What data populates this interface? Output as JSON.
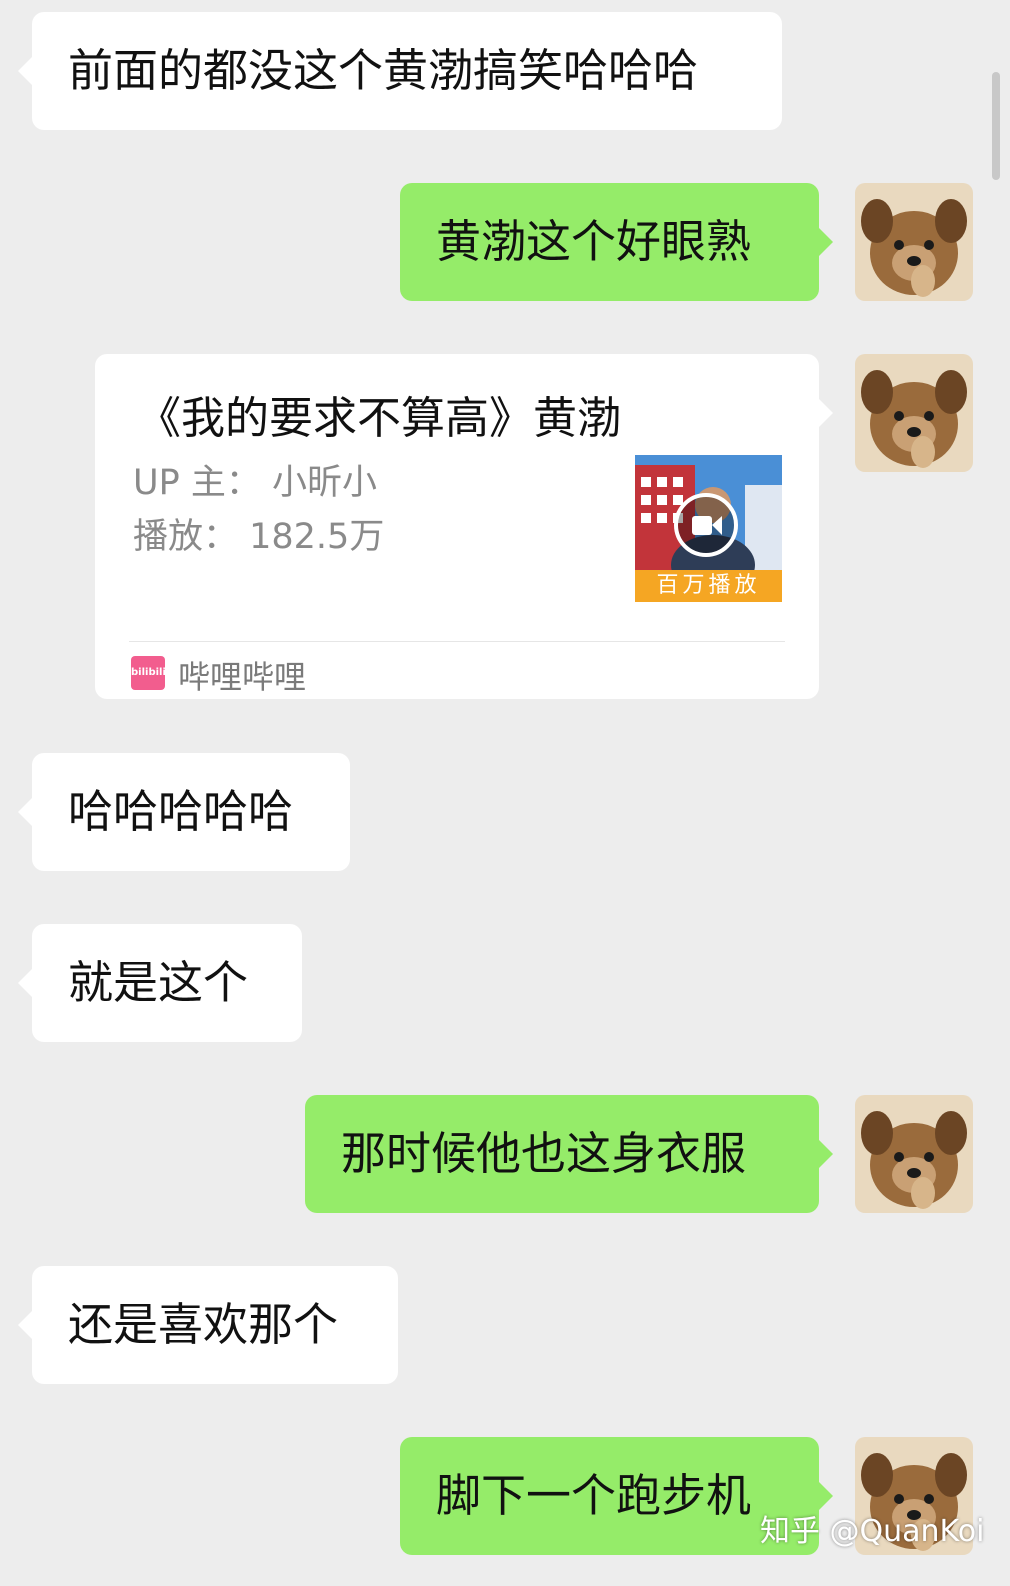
{
  "messages": [
    {
      "side": "left",
      "text": "前面的都没这个黄渤搞笑哈哈哈"
    },
    {
      "side": "right",
      "text": "黄渤这个好眼熟"
    },
    {
      "side": "left",
      "text": "哈哈哈哈哈"
    },
    {
      "side": "left",
      "text": "就是这个"
    },
    {
      "side": "right",
      "text": "那时候他也这身衣服"
    },
    {
      "side": "left",
      "text": "还是喜欢那个"
    },
    {
      "side": "right",
      "text": "脚下一个跑步机"
    }
  ],
  "video_card": {
    "title": "《我的要求不算高》黄渤",
    "uploader": "UP 主：  小昕小",
    "plays": "播放：  182.5万",
    "thumbnail_badge": "百万播放",
    "source_icon_text": "bilibili",
    "source": "哔哩哔哩"
  },
  "avatar_icon": "puppy-avatar",
  "watermark": "知乎 @QuanKoi",
  "colors": {
    "background": "#ededed",
    "incoming_bubble": "#ffffff",
    "outgoing_bubble": "#95ec69",
    "badge": "#f5a623",
    "bilibili_pink": "#f25d8e"
  }
}
